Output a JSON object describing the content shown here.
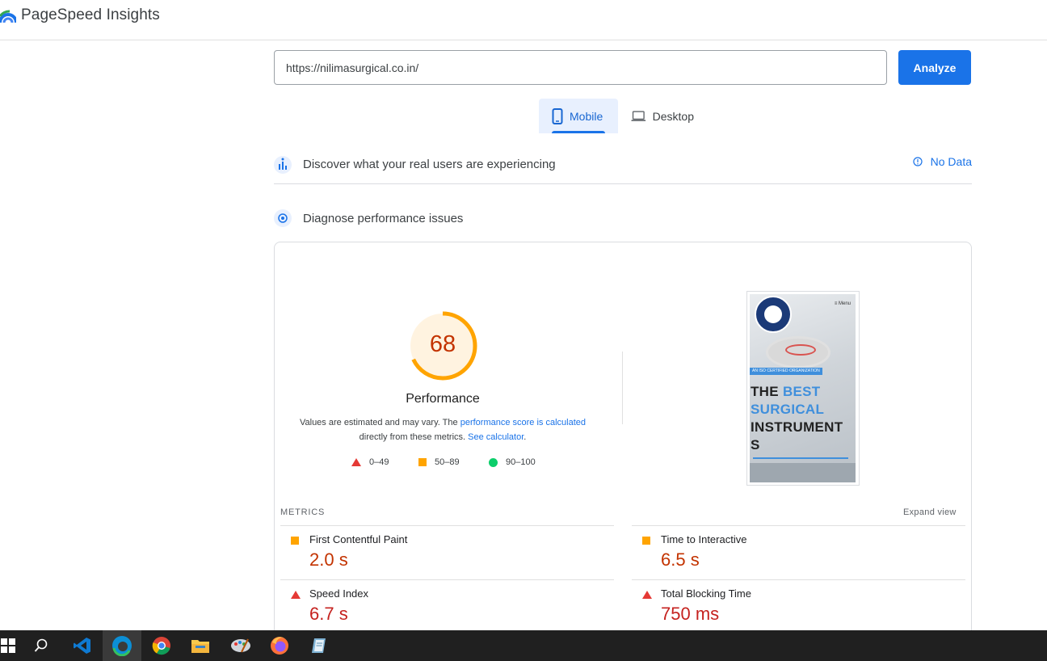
{
  "header": {
    "brand": "PageSpeed Insights"
  },
  "search": {
    "url_value": "https://nilimasurgical.co.in/",
    "analyze_label": "Analyze"
  },
  "tabs": [
    {
      "label": "Mobile",
      "selected": true
    },
    {
      "label": "Desktop",
      "selected": false
    }
  ],
  "real_users": {
    "title": "Discover what your real users are experiencing",
    "no_data_label": "No Data"
  },
  "diagnose": {
    "title": "Diagnose performance issues"
  },
  "performance": {
    "score": "68",
    "score_value": 68,
    "label": "Performance",
    "note_part1": "Values are estimated and may vary. The ",
    "note_link1": "performance score is calculated",
    "note_part2": " directly from these metrics. ",
    "note_link2": "See calculator",
    "note_end": "."
  },
  "legend": [
    {
      "label": "0–49",
      "color": "#e53935"
    },
    {
      "label": "50–89",
      "color": "#ffa400"
    },
    {
      "label": "90–100",
      "color": "#0cce6b"
    }
  ],
  "screenshot": {
    "menu": "≡ Menu",
    "badge": "AN ISO CERTIFIED ORGANIZATION",
    "word_the": "THE ",
    "word_best": "BEST",
    "word_surgical": "SURGICAL",
    "word_instrument": "INSTRUMENT",
    "word_s": "S"
  },
  "metrics": {
    "title": "METRICS",
    "expand_label": "Expand view",
    "items": [
      {
        "label": "First Contentful Paint",
        "value": "2.0 s",
        "status": "average"
      },
      {
        "label": "Time to Interactive",
        "value": "6.5 s",
        "status": "average"
      },
      {
        "label": "Speed Index",
        "value": "6.7 s",
        "status": "fail"
      },
      {
        "label": "Total Blocking Time",
        "value": "750 ms",
        "status": "fail"
      }
    ]
  },
  "colors": {
    "accent": "#1a73e8",
    "average": "#ffa400",
    "fail": "#e53935",
    "score_text": "#c33300"
  },
  "taskbar": {
    "icons": [
      "windows-start-icon",
      "search-icon",
      "vscode-icon",
      "edge-icon",
      "chrome-icon",
      "file-explorer-icon",
      "paint-icon",
      "firefox-icon",
      "notepad-icon"
    ],
    "active": "edge-icon"
  }
}
